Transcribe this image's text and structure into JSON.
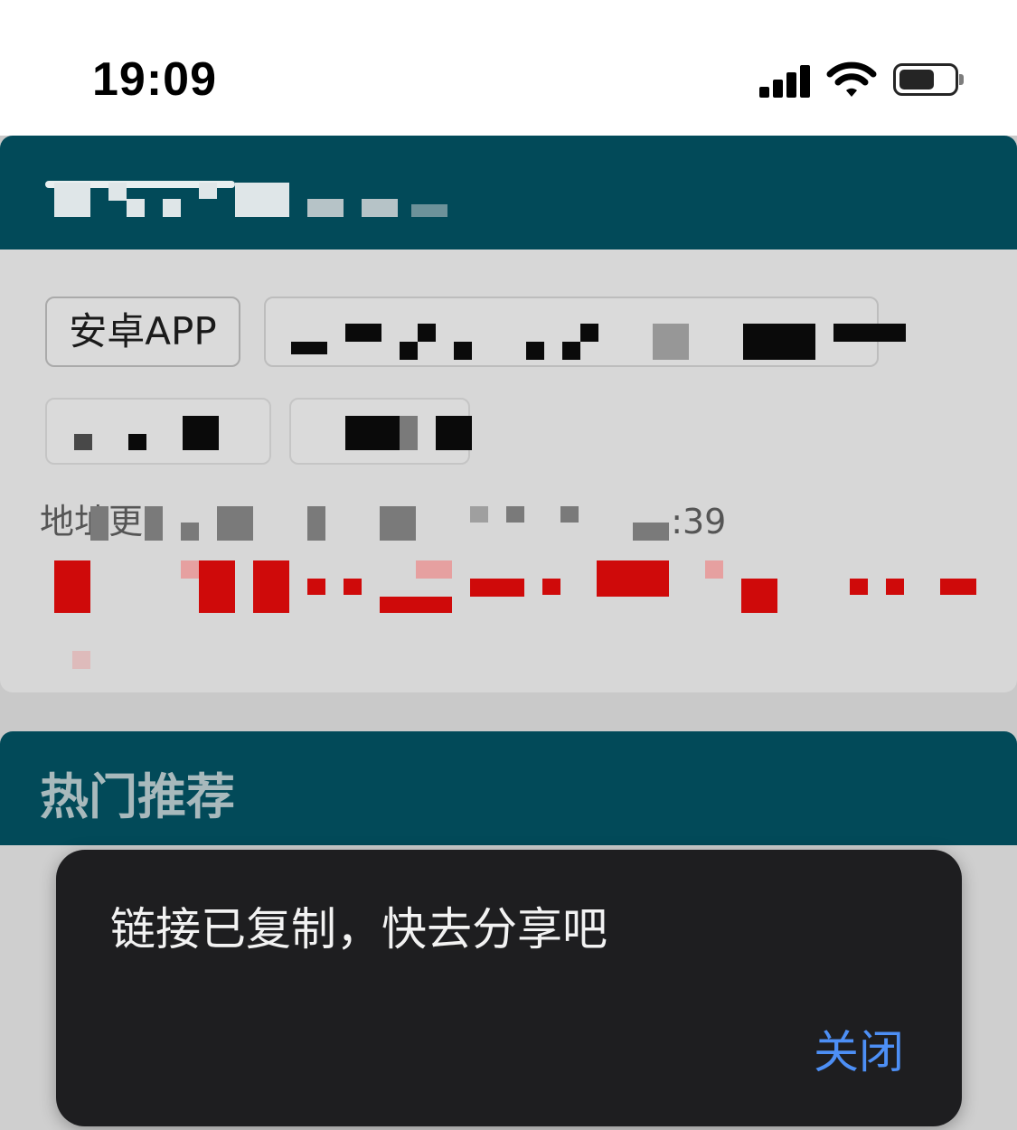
{
  "status_bar": {
    "time": "19:09",
    "icons": [
      "signal-icon",
      "wifi-icon",
      "battery-icon"
    ]
  },
  "card": {
    "tag_label": "安卓APP",
    "address_prefix": "地址更",
    "address_time_fragment": ":39"
  },
  "hot_section": {
    "title": "热门推荐"
  },
  "toast": {
    "message": "链接已复制，快去分享吧",
    "close_label": "关闭"
  },
  "colors": {
    "header_teal": "#024a59",
    "toast_bg": "#1e1e20",
    "close_blue": "#4d8ff5",
    "redacted_red": "#cf0a0a"
  }
}
